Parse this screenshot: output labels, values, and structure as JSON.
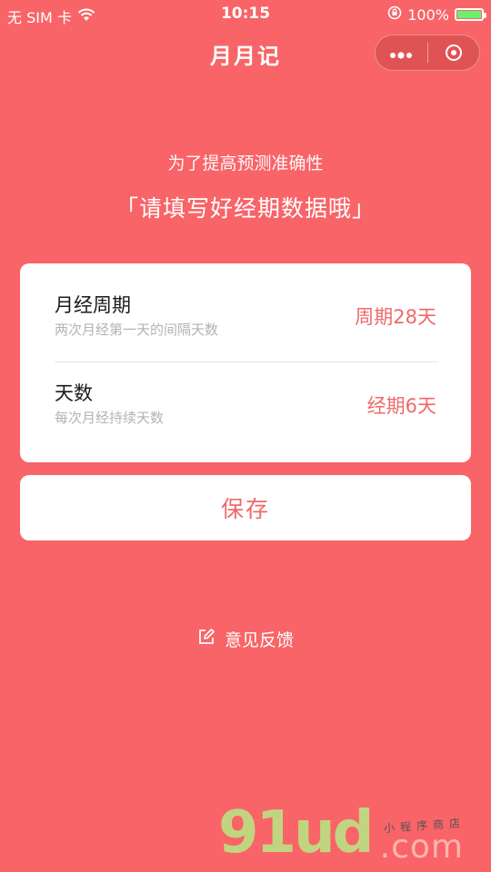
{
  "status_bar": {
    "carrier": "无 SIM 卡",
    "time": "10:15",
    "battery_percent": "100%",
    "battery_level": 1.0
  },
  "nav": {
    "title": "月月记",
    "more_icon": "more-dots-icon",
    "close_icon": "target-icon"
  },
  "intro": {
    "subtitle": "为了提高预测准确性",
    "headline": "「请填写好经期数据哦」"
  },
  "settings": [
    {
      "title": "月经周期",
      "description": "两次月经第一天的间隔天数",
      "value": "周期28天"
    },
    {
      "title": "天数",
      "description": "每次月经持续天数",
      "value": "经期6天"
    }
  ],
  "save_button": {
    "label": "保存"
  },
  "feedback": {
    "label": "意见反馈",
    "icon": "edit-icon"
  },
  "watermark": {
    "text": "91ud",
    "domain": ".com",
    "sub": "小程序商店"
  },
  "colors": {
    "background": "#f86467",
    "accent_text": "#ee6a69",
    "card": "#ffffff"
  }
}
